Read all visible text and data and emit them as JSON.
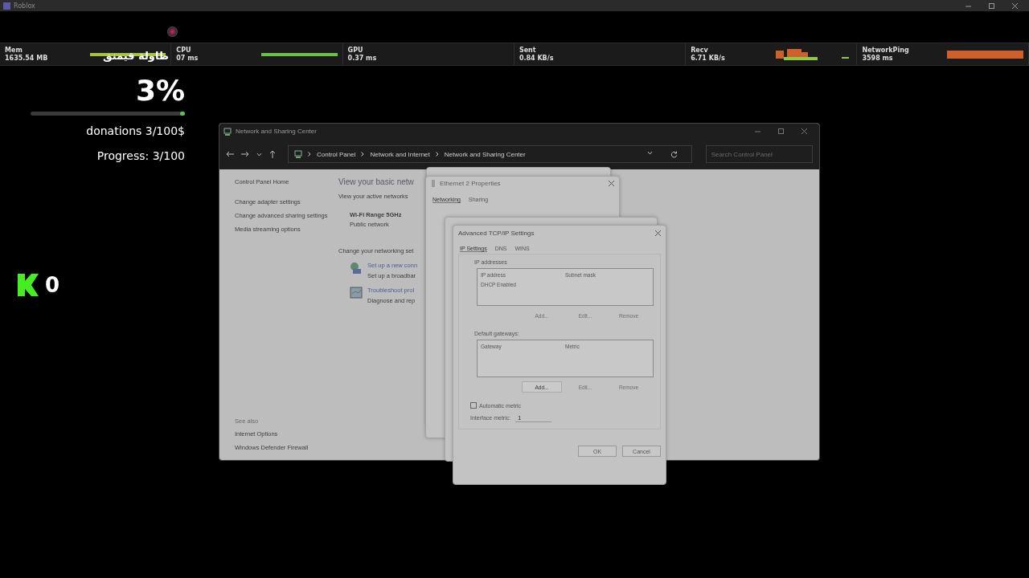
{
  "app_window": {
    "title": "Roblox"
  },
  "stats": [
    {
      "label": "Mem",
      "value": "1635.54 MB",
      "kind": "bar",
      "color": "#a8c43c"
    },
    {
      "label": "CPU",
      "value": "07 ms",
      "kind": "bar",
      "color": "#6cc04a"
    },
    {
      "label": "GPU",
      "value": "0.37 ms"
    },
    {
      "label": "Sent",
      "value": "0.84 KB/s"
    },
    {
      "label": "Recv",
      "value": "6.71 KB/s",
      "kind": "histogram",
      "color": "#d0602a"
    },
    {
      "label": "NetworkPing",
      "value": "3598 ms",
      "kind": "bar",
      "color": "#d0602a"
    }
  ],
  "hud": {
    "overlay_title": "طاولة قيمنق",
    "percent": "3%",
    "progress_bar": {
      "level": 0.03
    },
    "donations": "donations 3/100$",
    "progress": "Progress: 3/100",
    "coins": "0"
  },
  "network_window": {
    "title": "Network and Sharing Center",
    "breadcrumbs": [
      "Control Panel",
      "Network and Internet",
      "Network and Sharing Center"
    ],
    "search": {
      "placeholder": "Search Control Panel"
    },
    "sidebar": [
      "Control Panel Home",
      "Change adapter settings",
      "Change advanced sharing settings",
      "Media streaming options"
    ],
    "see_also": {
      "heading": "See also",
      "links": [
        "Internet Options",
        "Windows Defender Firewall"
      ]
    },
    "heading": "View your basic netw",
    "active_networks_label": "View your active networks",
    "network": {
      "name": "Wi-Fi Range 5GHz",
      "type": "Public network"
    },
    "change_label": "Change your networking set",
    "tasks": [
      {
        "link": "Set up a new conn",
        "desc": "Set up a broadbar",
        "kind": "setup"
      },
      {
        "link": "Troubleshoot prol",
        "desc": "Diagnose and rep",
        "kind": "troubleshoot"
      }
    ]
  },
  "properties_dialog": {
    "title": "Ethernet 2 Properties",
    "tabs": [
      {
        "label": "Networking",
        "selected": true
      },
      {
        "label": "Sharing",
        "selected": false
      }
    ]
  },
  "advanced_dialog": {
    "title": "Advanced TCP/IP Settings",
    "tabs": [
      {
        "label": "IP Settings",
        "selected": true
      },
      {
        "label": "DNS",
        "selected": false
      },
      {
        "label": "WINS",
        "selected": false
      }
    ],
    "groups": [
      {
        "label": "IP addresses",
        "columns": [
          "IP address",
          "Subnet mask"
        ],
        "rows": [
          "DHCP Enabled"
        ],
        "buttons": [
          {
            "label": "Add...",
            "disabled": true
          },
          {
            "label": "Edit...",
            "disabled": true
          },
          {
            "label": "Remove",
            "disabled": true
          }
        ]
      },
      {
        "label": "Default gateways:",
        "columns": [
          "Gateway",
          "Metric"
        ],
        "buttons": [
          {
            "label": "Add...",
            "disabled": false
          },
          {
            "label": "Edit...",
            "disabled": true
          },
          {
            "label": "Remove",
            "disabled": true
          }
        ]
      }
    ],
    "automatic_metric": {
      "label": "Automatic metric",
      "checked": false
    },
    "interface_metric": {
      "label": "Interface metric:",
      "value": "1"
    },
    "buttons": [
      "OK",
      "Cancel"
    ]
  }
}
